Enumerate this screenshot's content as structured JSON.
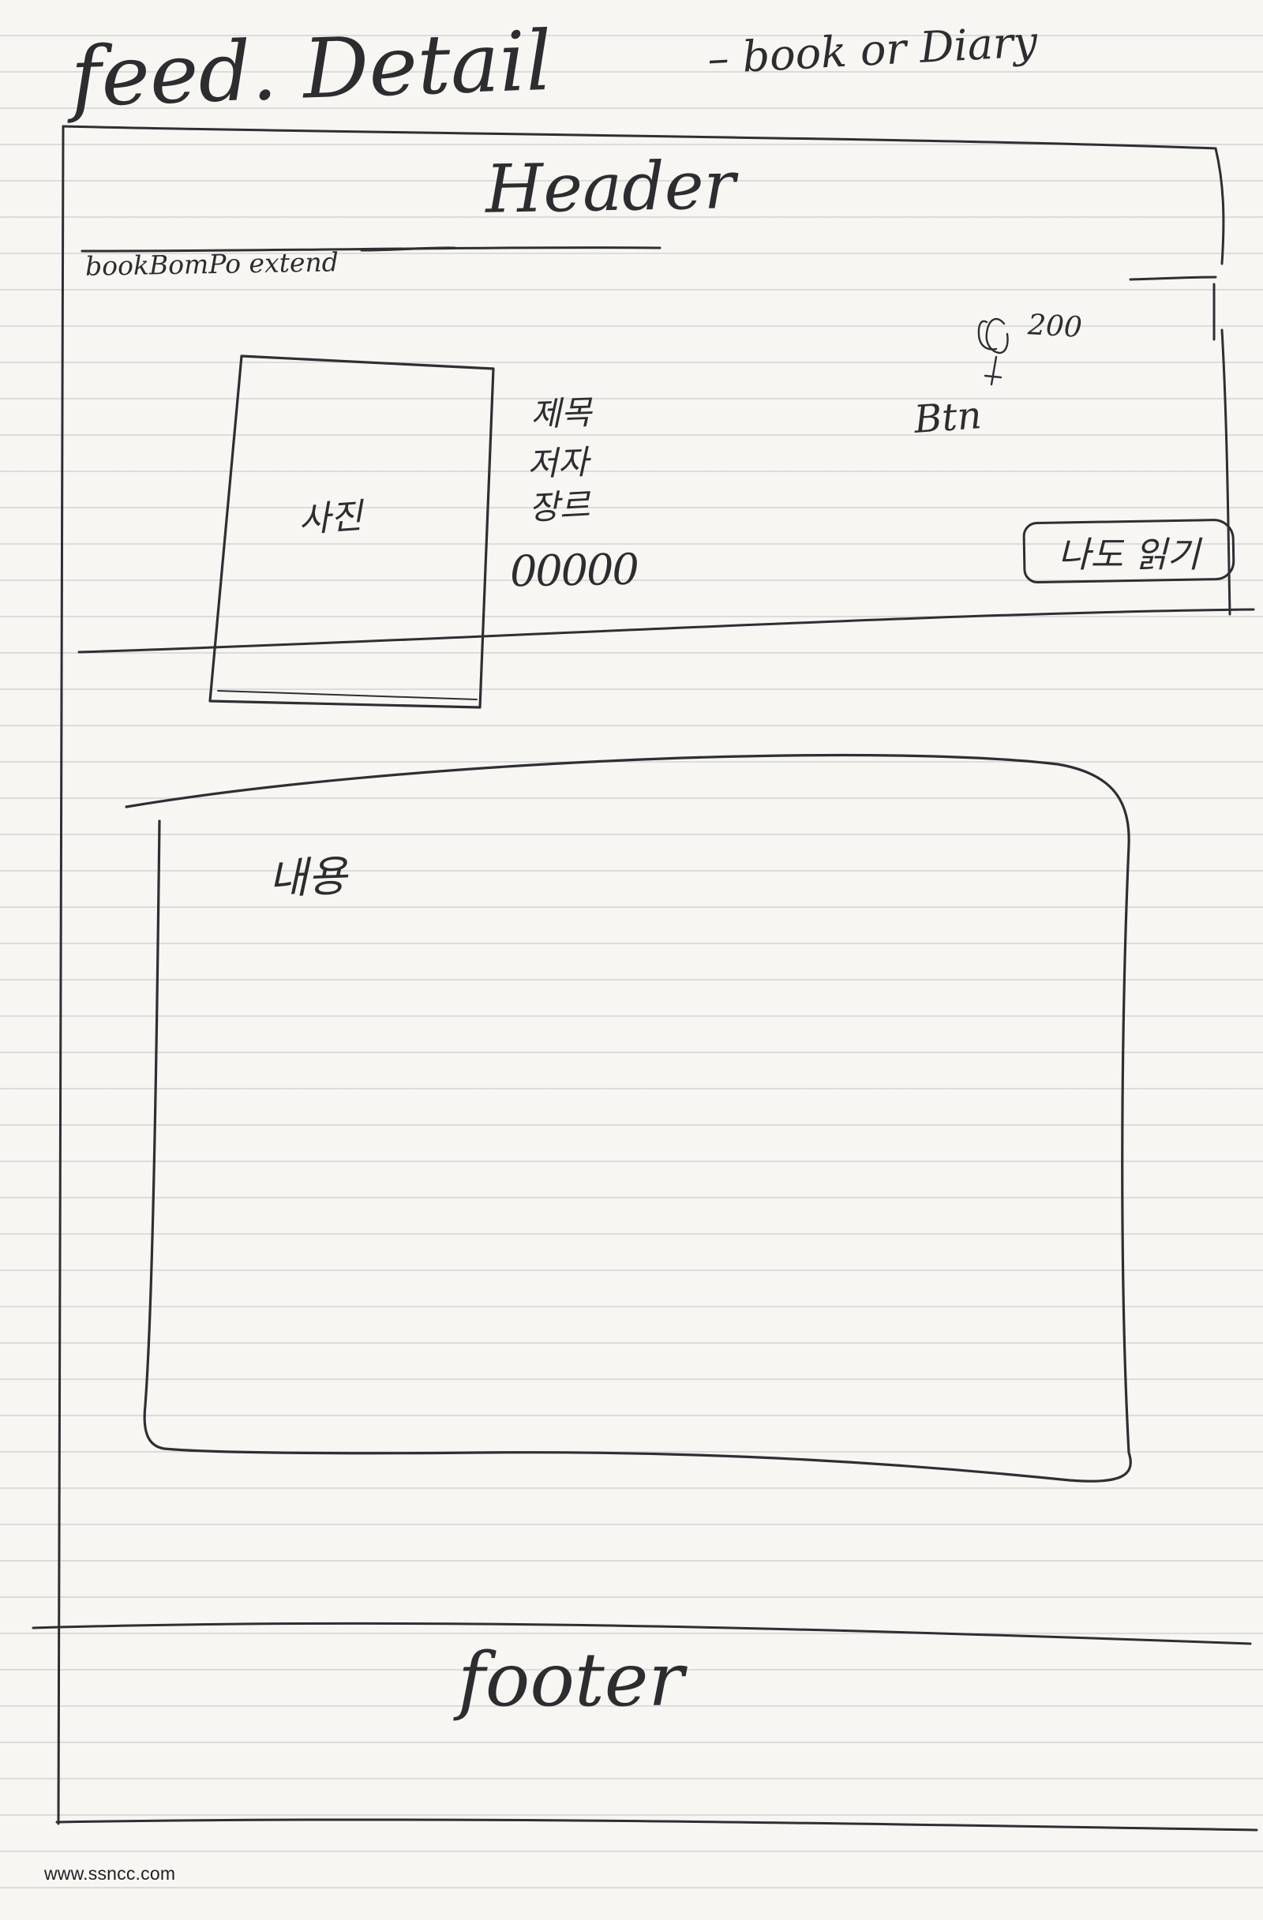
{
  "page": {
    "title": "feed. Detail",
    "subtitle": "– book or Diary",
    "watermark": "www.ssncc.com"
  },
  "header": {
    "label": "Header"
  },
  "component": {
    "label": "bookBomPo extend"
  },
  "book_card": {
    "image_label": "사진",
    "fields": [
      "제목",
      "저자",
      "장르"
    ],
    "rating": "00000",
    "count": "200",
    "btn_label": "Btn",
    "button_label": "나도 읽기"
  },
  "content": {
    "label": "내용"
  },
  "footer": {
    "label": "footer"
  }
}
